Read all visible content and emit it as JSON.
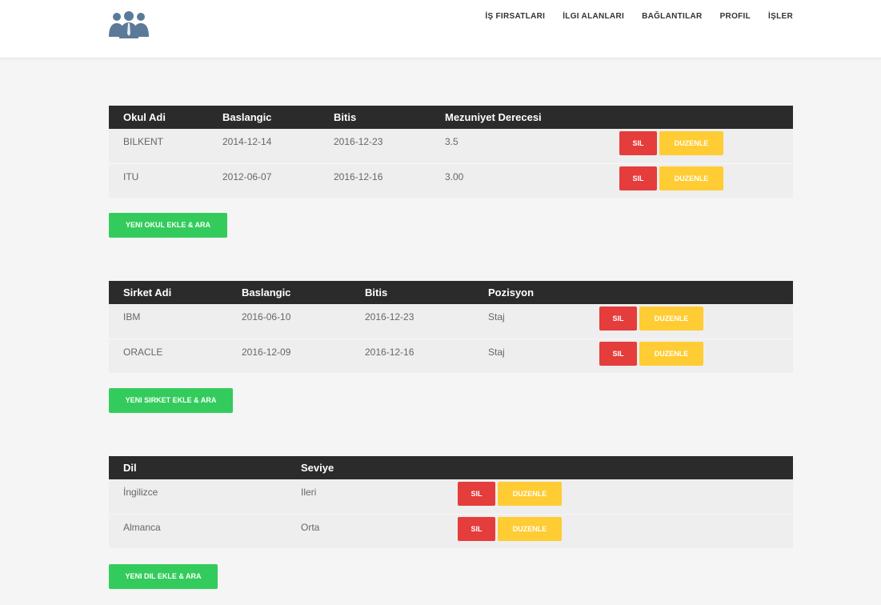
{
  "nav": {
    "items": [
      "İŞ FIRSATLARI",
      "İLGI ALANLARI",
      "BAĞLANTILAR",
      "PROFIL",
      "İŞLER"
    ]
  },
  "education": {
    "headers": [
      "Okul Adi",
      "Baslangic",
      "Bitis",
      "Mezuniyet Derecesi"
    ],
    "rows": [
      [
        "BILKENT",
        "2014-12-14",
        "2016-12-23",
        "3.5"
      ],
      [
        "ITU",
        "2012-06-07",
        "2016-12-16",
        "3.00"
      ]
    ],
    "add_label": "YENI OKUL EKLE & ARA"
  },
  "work": {
    "headers": [
      "Sirket Adi",
      "Baslangic",
      "Bitis",
      "Pozisyon"
    ],
    "rows": [
      [
        "IBM",
        "2016-06-10",
        "2016-12-23",
        "Staj"
      ],
      [
        "ORACLE",
        "2016-12-09",
        "2016-12-16",
        "Staj"
      ]
    ],
    "add_label": "YENI SIRKET EKLE & ARA"
  },
  "languages": {
    "headers": [
      "Dil",
      "Seviye"
    ],
    "rows": [
      [
        "İngilizce",
        "Ileri"
      ],
      [
        "Almanca",
        "Orta"
      ]
    ],
    "add_label": "YENI DIL EKLE & ARA"
  },
  "actions": {
    "delete_label": "SIL",
    "edit_label": "DUZENLE"
  },
  "colors": {
    "header_bg": "#2b2b2b",
    "delete": "#e53c3c",
    "edit": "#ffcc33",
    "add": "#33cc5c",
    "logo": "#5b7a99"
  },
  "icons": {
    "logo": "people-group-icon"
  }
}
